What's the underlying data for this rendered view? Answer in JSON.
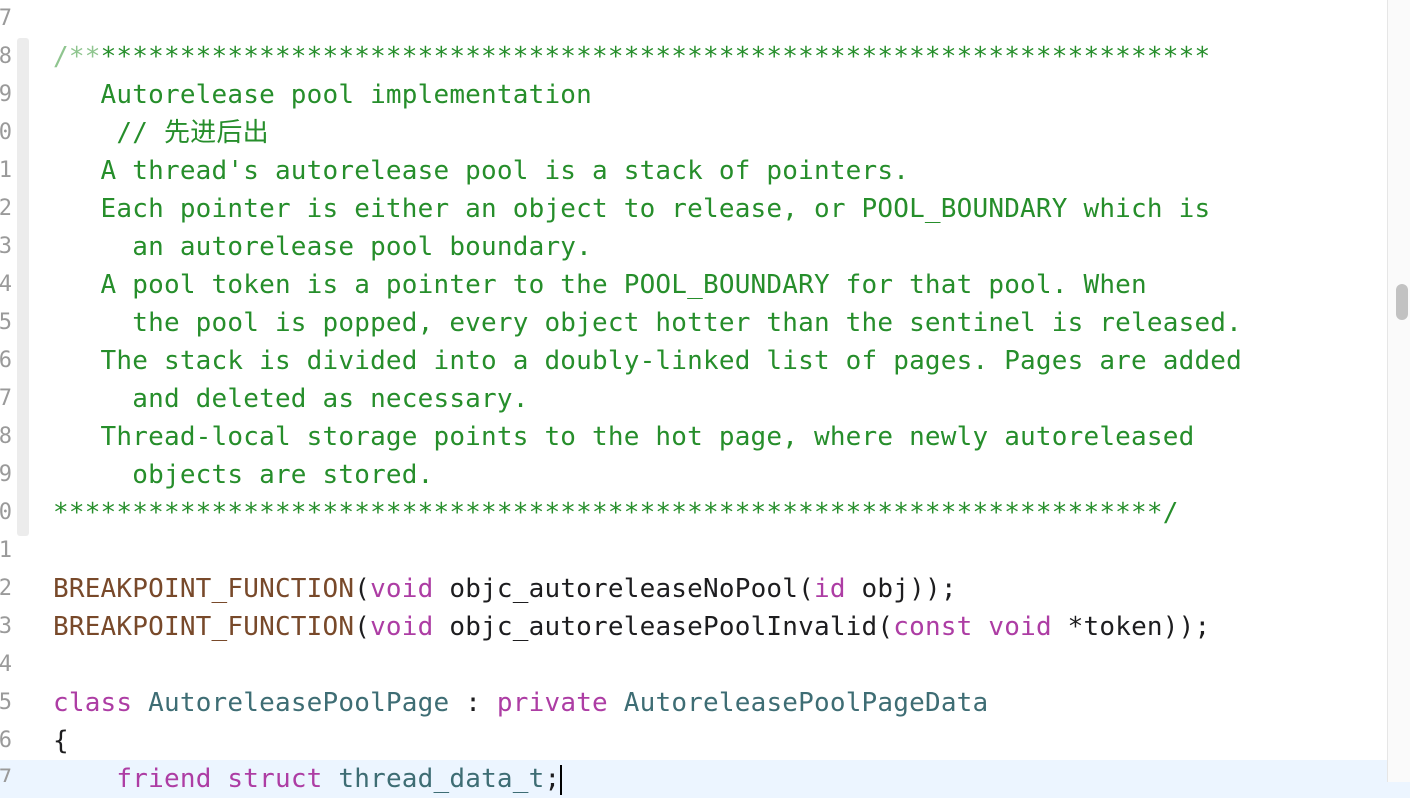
{
  "gutter": {
    "line_numbers": [
      "7",
      "8",
      "9",
      "0",
      "1",
      "2",
      "3",
      "4",
      "5",
      "6",
      "7",
      "8",
      "9",
      "0",
      "1",
      "2",
      "3",
      "4",
      "5",
      "6",
      "7"
    ]
  },
  "code": {
    "comment_open_light": "/**",
    "comment_open_rest": "**********************************************************************",
    "comment_lines": [
      "   Autorelease pool implementation",
      "    // 先进后出",
      "   A thread's autorelease pool is a stack of pointers.",
      "   Each pointer is either an object to release, or POOL_BOUNDARY which is",
      "     an autorelease pool boundary.",
      "   A pool token is a pointer to the POOL_BOUNDARY for that pool. When",
      "     the pool is popped, every object hotter than the sentinel is released.",
      "   The stack is divided into a doubly-linked list of pages. Pages are added",
      "     and deleted as necessary.",
      "   Thread-local storage points to the hot page, where newly autoreleased",
      "     objects are stored."
    ],
    "comment_close": "**********************************************************************/",
    "bp1": {
      "macro": "BREAKPOINT_FUNCTION",
      "p1": "(",
      "kw": "void",
      "rest1": " objc_autoreleaseNoPool(",
      "kw2": "id",
      "rest2": " obj));"
    },
    "bp2": {
      "macro": "BREAKPOINT_FUNCTION",
      "p1": "(",
      "kw": "void",
      "rest1": " objc_autoreleasePoolInvalid(",
      "kw2": "const",
      "sp": " ",
      "kw3": "void",
      "rest2": " *token));"
    },
    "class_line": {
      "kw": "class",
      "name": " AutoreleasePoolPage",
      "colon": " : ",
      "kw2": "private",
      "base": " AutoreleasePoolPageData"
    },
    "brace": "{",
    "friend_line": {
      "indent": "    ",
      "kw": "friend",
      "sp": " ",
      "kw2": "struct",
      "type": " thread_data_t",
      "end": ";"
    }
  }
}
